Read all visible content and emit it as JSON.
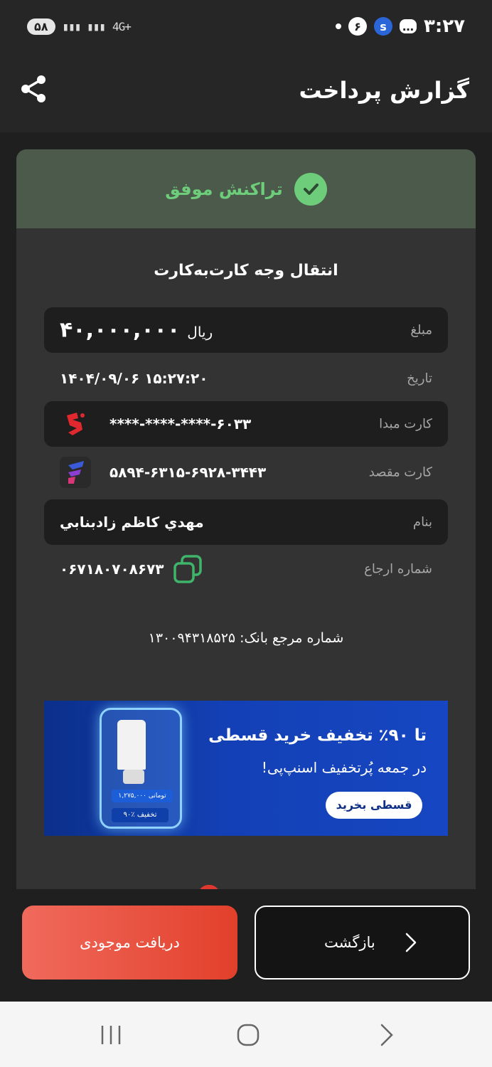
{
  "status_bar": {
    "time": "۳:۲۷",
    "notif_count": "۶",
    "battery": "۵۸",
    "signal": "4G+"
  },
  "header": {
    "title": "گزارش پرداخت"
  },
  "transaction": {
    "status": "تراکنش موفق",
    "type": "انتقال وجه کارت‌به‌کارت",
    "amount_label": "مبلغ",
    "amount_value": "۴۰,۰۰۰,۰۰۰",
    "amount_unit": "ریال",
    "date_label": "تاریخ",
    "date_value": "۱۴۰۴/۰۹/۰۶  ۱۵:۲۷:۲۰",
    "source_label": "کارت مبدا",
    "source_value": "****-****-****-۶۰۳۳",
    "dest_label": "کارت مقصد",
    "dest_value": "۵۸۹۴-۶۳۱۵-۶۹۲۸-۳۴۴۳",
    "name_label": "بنام",
    "name_value": "مهدي كاظم زادبنابي",
    "ref_label": "شماره ارجاع",
    "ref_value": "۰۶۷۱۸۰۷۰۸۶۷۳",
    "bank_ref": "شماره مرجع بانک: ۱۳۰۰۹۴۳۱۸۵۲۵"
  },
  "banner": {
    "headline": "تا ۹۰٪ تخفیف خرید قسطی",
    "subline": "در جمعه پُرتخفیف اسنپ‌پی!",
    "button": "قسطی بخرید",
    "price_tag": "۱,۲۷۵,۰۰۰ تومانی",
    "discount_tag": "۹۰٪ تخفیف"
  },
  "actions": {
    "balance_label": "دریافت موجودی",
    "back_label": "بازگشت"
  },
  "colors": {
    "success": "#6dcd7a",
    "accent": "#e2402b"
  }
}
